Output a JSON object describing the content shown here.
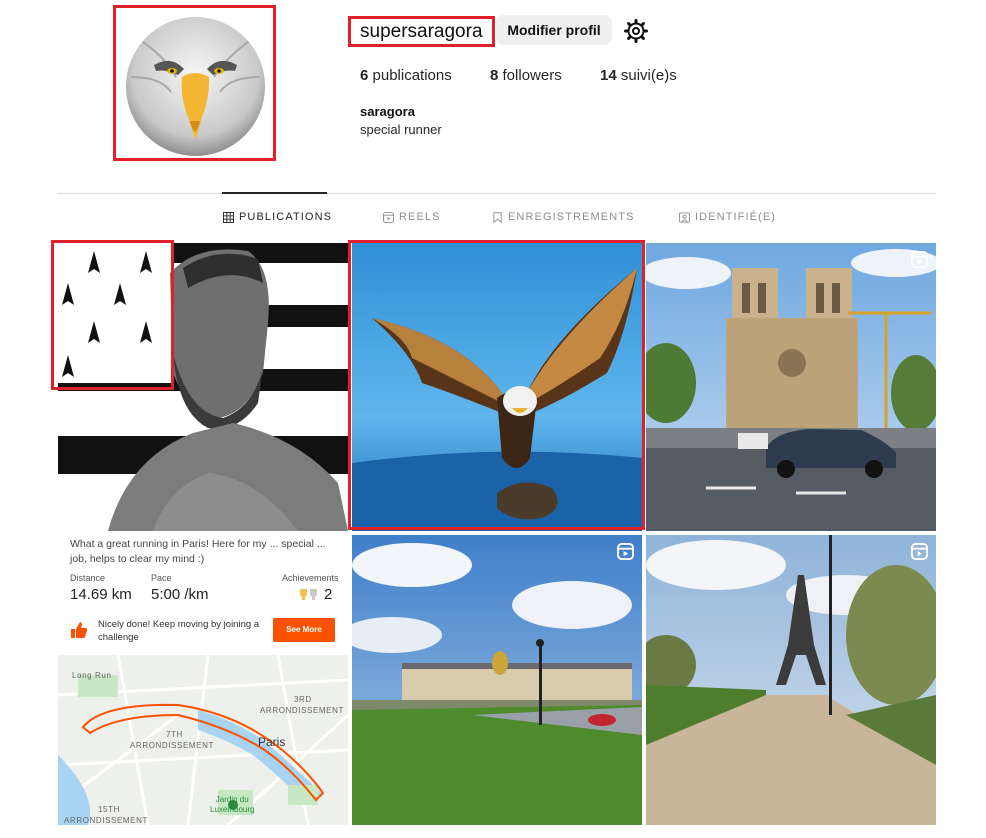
{
  "profile": {
    "username": "supersaragora",
    "edit_label": "Modifier profil",
    "stats": {
      "publications_count": "6",
      "publications_label": "publications",
      "followers_count": "8",
      "followers_label": "followers",
      "following_count": "14",
      "following_label": "suivi(e)s"
    },
    "name": "saragora",
    "bio": "special runner"
  },
  "tabs": [
    {
      "label": "PUBLICATIONS",
      "icon": "grid-icon",
      "active": true
    },
    {
      "label": "REELS",
      "icon": "reels-icon",
      "active": false
    },
    {
      "label": "ENREGISTREMENTS",
      "icon": "bookmark-icon",
      "active": false
    },
    {
      "label": "IDENTIFIÉ(E)",
      "icon": "tag-icon",
      "active": false
    }
  ],
  "posts": {
    "strava": {
      "caption": "What a great running in Paris! Here for my ... special ... job, helps to clear my mind :)",
      "distance_label": "Distance",
      "distance_value": "14.69 km",
      "pace_label": "Pace",
      "pace_value": "5:00 /km",
      "achievements_label": "Achievements",
      "achievements_value": "2",
      "encourage": "Nicely done! Keep moving by joining a challenge",
      "see_more": "See More",
      "map_labels": {
        "long_run": "Long Run",
        "arr3_a": "3RD",
        "arr3_b": "ARRONDISSEMENT",
        "arr7_a": "7TH",
        "arr7_b": "ARRONDISSEMENT",
        "paris": "Paris",
        "park_a": "Jardin du",
        "park_b": "Luxembourg",
        "arr15_a": "15TH",
        "arr15_b": "ARRONDISSEMENT"
      }
    }
  },
  "colors": {
    "highlight": "#e0202a",
    "strava_orange": "#fc5200"
  }
}
